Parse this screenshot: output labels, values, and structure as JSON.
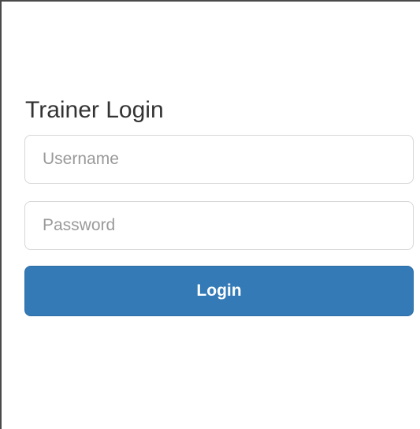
{
  "form": {
    "title": "Trainer Login",
    "username_placeholder": "Username",
    "password_placeholder": "Password",
    "login_label": "Login"
  },
  "colors": {
    "primary_button": "#337ab7",
    "title_text": "#333333",
    "placeholder_text": "#9a9a9a",
    "input_border": "#d6d6d6"
  }
}
